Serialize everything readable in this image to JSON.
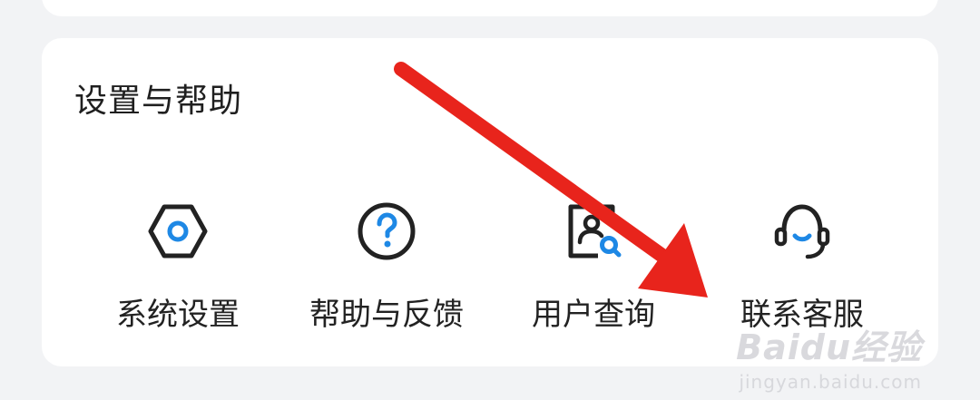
{
  "section": {
    "title": "设置与帮助"
  },
  "items": [
    {
      "label": "系统设置",
      "icon": "settings-hex-icon"
    },
    {
      "label": "帮助与反馈",
      "icon": "help-question-icon"
    },
    {
      "label": "用户查询",
      "icon": "user-search-icon"
    },
    {
      "label": "联系客服",
      "icon": "headset-icon"
    }
  ],
  "colors": {
    "accent": "#1e88e5",
    "icon_stroke": "#222222",
    "arrow": "#e8241c",
    "background": "#f2f3f5",
    "card": "#ffffff"
  },
  "watermark": {
    "brand": "Baidu经验",
    "domain": "jingyan.baidu.com"
  }
}
